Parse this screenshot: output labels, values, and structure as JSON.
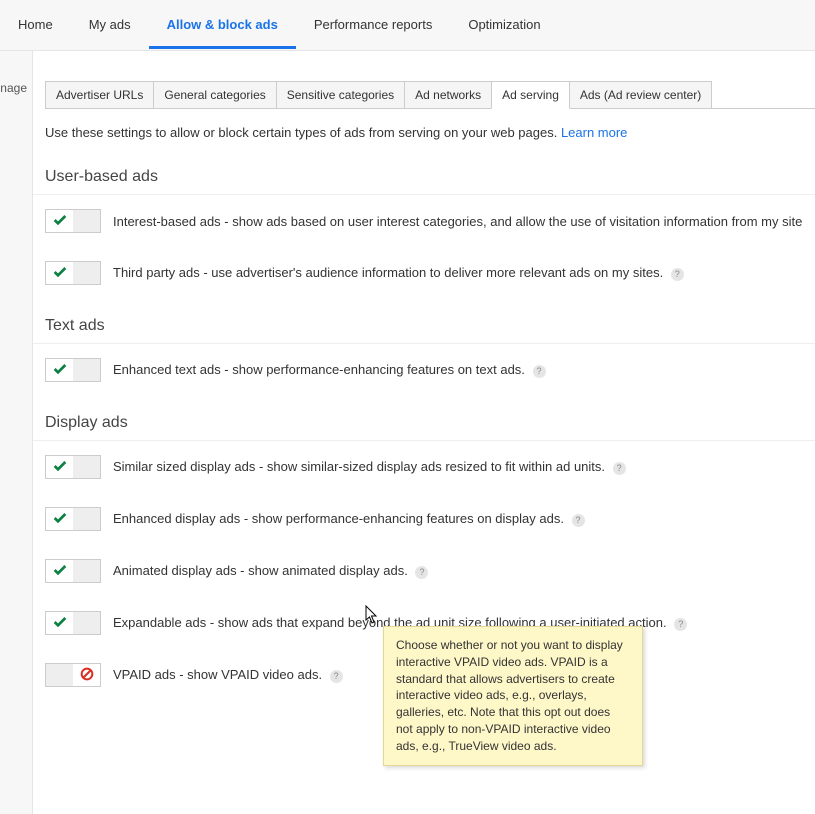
{
  "topnav": {
    "items": [
      {
        "label": "Home"
      },
      {
        "label": "My ads"
      },
      {
        "label": "Allow & block ads",
        "active": true
      },
      {
        "label": "Performance reports"
      },
      {
        "label": "Optimization"
      }
    ]
  },
  "leftcol": {
    "label": "nage"
  },
  "tabs": {
    "items": [
      {
        "label": "Advertiser URLs"
      },
      {
        "label": "General categories"
      },
      {
        "label": "Sensitive categories"
      },
      {
        "label": "Ad networks"
      },
      {
        "label": "Ad serving",
        "active": true
      },
      {
        "label": "Ads (Ad review center)"
      }
    ]
  },
  "intro": {
    "text": "Use these settings to allow or block certain types of ads from serving on your web pages. ",
    "link": "Learn more"
  },
  "sections": [
    {
      "title": "User-based ads",
      "settings": [
        {
          "on": true,
          "text": "Interest-based ads - show ads based on user interest categories, and allow the use of visitation information from my site t",
          "help": false
        },
        {
          "on": true,
          "text": "Third party ads - use advertiser's audience information to deliver more relevant ads on my sites.",
          "help": true
        }
      ]
    },
    {
      "title": "Text ads",
      "settings": [
        {
          "on": true,
          "text": "Enhanced text ads - show performance-enhancing features on text ads.",
          "help": true
        }
      ]
    },
    {
      "title": "Display ads",
      "settings": [
        {
          "on": true,
          "text": "Similar sized display ads - show similar-sized display ads resized to fit within ad units.",
          "help": true
        },
        {
          "on": true,
          "text": "Enhanced display ads - show performance-enhancing features on display ads.",
          "help": true
        },
        {
          "on": true,
          "text": "Animated display ads - show animated display ads.",
          "help": true
        },
        {
          "on": true,
          "text": "Expandable ads - show ads that expand beyond the ad unit size following a user-initiated action.",
          "help": true
        },
        {
          "on": false,
          "text": "VPAID ads - show VPAID video ads.",
          "help": true
        }
      ]
    }
  ],
  "tooltip": {
    "text": "Choose whether or not you want to display interactive VPAID video ads. VPAID is a standard that allows advertisers to create interactive video ads, e.g., overlays, galleries, etc. Note that this opt out does not apply to non-VPAID interactive video ads, e.g., TrueView video ads."
  }
}
